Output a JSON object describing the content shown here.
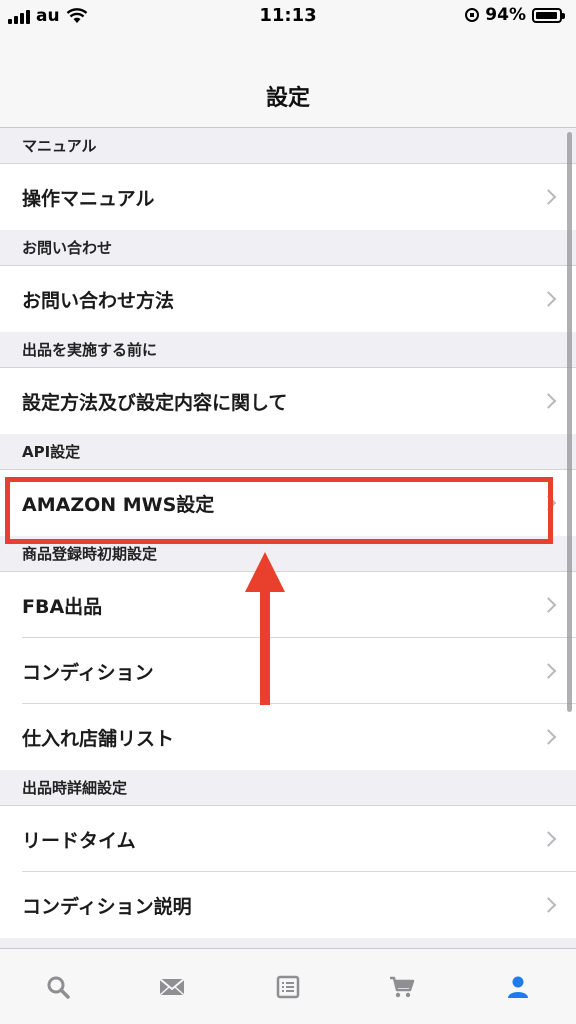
{
  "status_bar": {
    "carrier": "au",
    "time": "11:13",
    "battery": "94%"
  },
  "nav": {
    "title": "設定"
  },
  "sections": [
    {
      "header": "マニュアル",
      "rows": [
        "操作マニュアル"
      ]
    },
    {
      "header": "お問い合わせ",
      "rows": [
        "お問い合わせ方法"
      ]
    },
    {
      "header": "出品を実施する前に",
      "rows": [
        "設定方法及び設定内容に関して"
      ]
    },
    {
      "header": "API設定",
      "rows": [
        "AMAZON MWS設定"
      ]
    },
    {
      "header": "商品登録時初期設定",
      "rows": [
        "FBA出品",
        "コンディション",
        "仕入れ店舗リスト"
      ]
    },
    {
      "header": "出品時詳細設定",
      "rows": [
        "リードタイム",
        "コンディション説明"
      ]
    }
  ],
  "tabs": [
    {
      "icon": "search-icon",
      "active": false
    },
    {
      "icon": "mail-icon",
      "active": false
    },
    {
      "icon": "list-icon",
      "active": false
    },
    {
      "icon": "cart-icon",
      "active": false
    },
    {
      "icon": "person-icon",
      "active": true
    }
  ],
  "colors": {
    "accent": "#1e7cf0",
    "annotation": "#e8402c",
    "inactive_icon": "#8e8e93"
  }
}
